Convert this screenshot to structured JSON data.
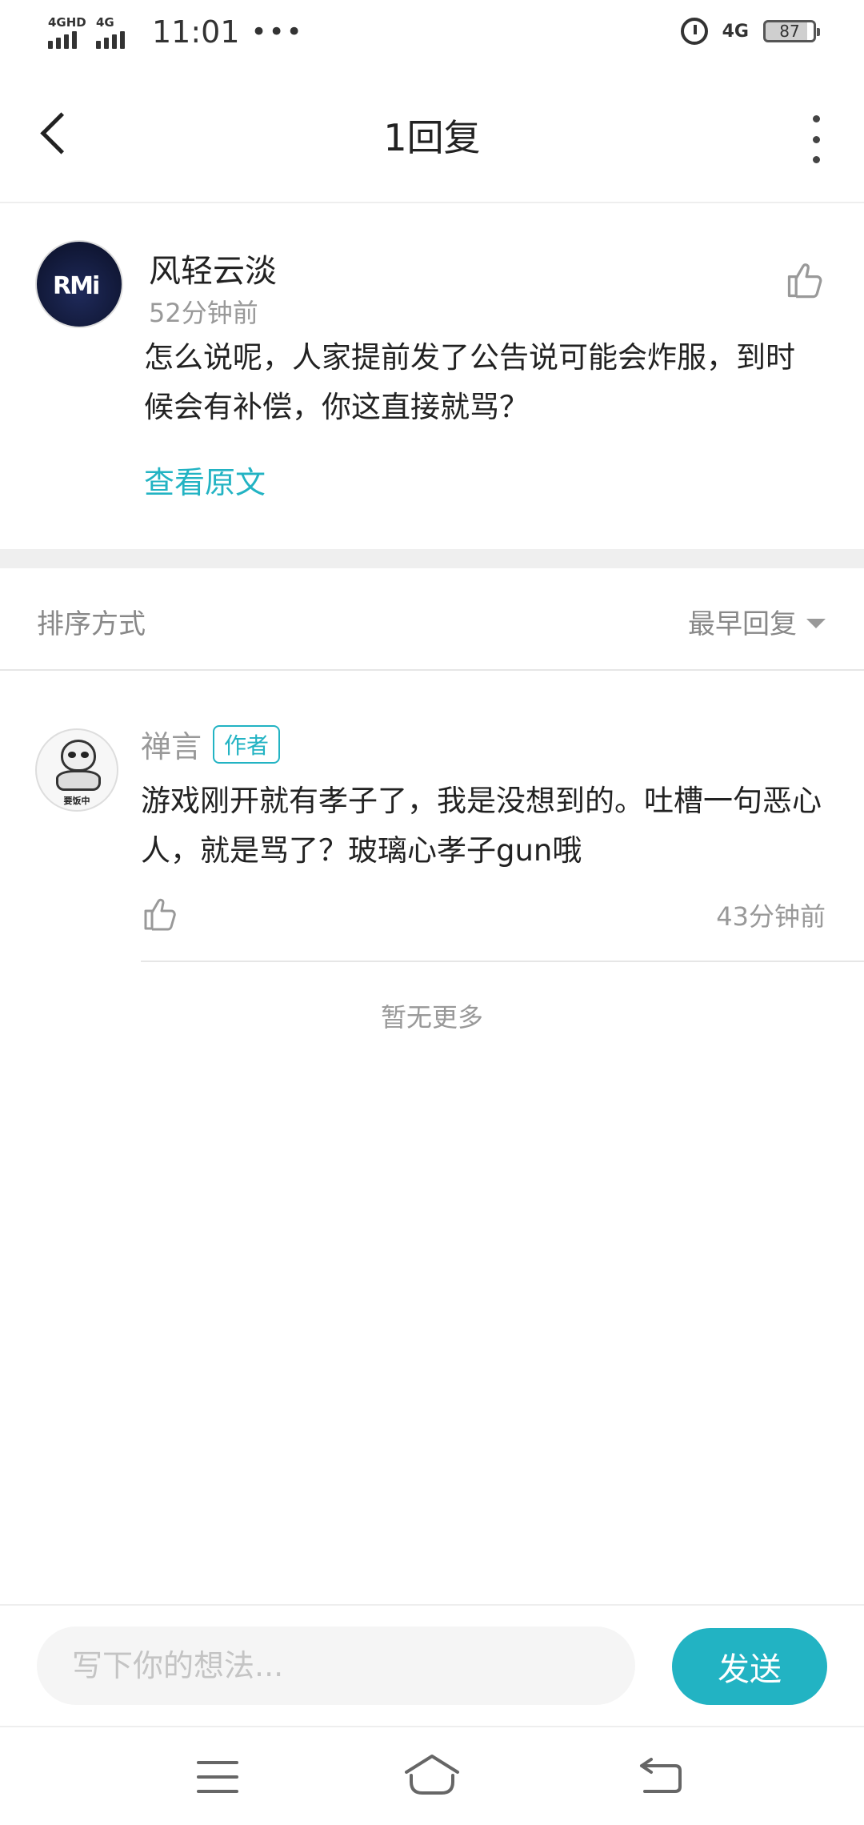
{
  "status_bar": {
    "signal1_label": "4GHD",
    "signal2_label": "4G",
    "time": "11:01",
    "overflow": "•••",
    "network": "4G",
    "battery": "87"
  },
  "header": {
    "title": "1回复"
  },
  "original_comment": {
    "user_name": "风轻云淡",
    "avatar_text": "RMi",
    "time": "52分钟前",
    "content": "怎么说呢，人家提前发了公告说可能会炸服，到时候会有补偿，你这直接就骂？",
    "view_original_label": "查看原文"
  },
  "sort": {
    "label": "排序方式",
    "selected": "最早回复"
  },
  "reply": {
    "user_name": "禅言",
    "badge": "作者",
    "avatar_caption": "要饭中",
    "content": "游戏刚开就有孝子了，我是没想到的。吐槽一句恶心人，就是骂了？玻璃心孝子gun哦",
    "time": "43分钟前"
  },
  "list_end_text": "暂无更多",
  "input_bar": {
    "placeholder": "写下你的想法...",
    "send_label": "发送"
  },
  "colors": {
    "accent": "#22b3c3",
    "secondary_text": "#999999"
  }
}
